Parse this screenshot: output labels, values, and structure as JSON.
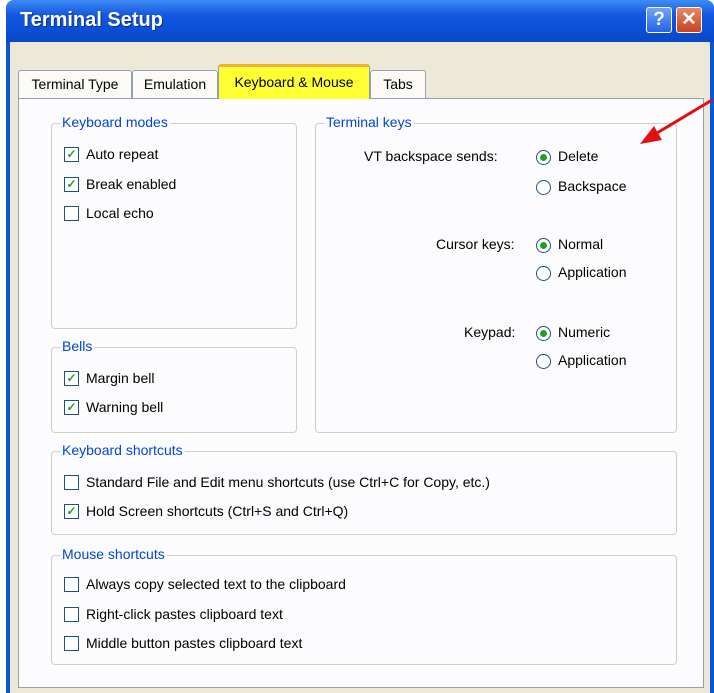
{
  "window": {
    "title": "Terminal Setup",
    "help_label": "?",
    "close_label": "✕"
  },
  "tabs": [
    {
      "label": "Terminal Type",
      "active": false
    },
    {
      "label": "Emulation",
      "active": false
    },
    {
      "label": "Keyboard & Mouse",
      "active": true
    },
    {
      "label": "Tabs",
      "active": false
    }
  ],
  "keyboard_modes": {
    "legend": "Keyboard modes",
    "items": [
      {
        "label": "Auto repeat",
        "checked": true
      },
      {
        "label": "Break enabled",
        "checked": true
      },
      {
        "label": "Local echo",
        "checked": false
      }
    ]
  },
  "bells": {
    "legend": "Bells",
    "items": [
      {
        "label": "Margin bell",
        "checked": true
      },
      {
        "label": "Warning bell",
        "checked": true
      }
    ]
  },
  "terminal_keys": {
    "legend": "Terminal keys",
    "vt_backspace": {
      "label": "VT backspace sends:",
      "options": [
        "Delete",
        "Backspace"
      ],
      "selected": "Delete"
    },
    "cursor_keys": {
      "label": "Cursor keys:",
      "options": [
        "Normal",
        "Application"
      ],
      "selected": "Normal"
    },
    "keypad": {
      "label": "Keypad:",
      "options": [
        "Numeric",
        "Application"
      ],
      "selected": "Numeric"
    }
  },
  "keyboard_shortcuts": {
    "legend": "Keyboard shortcuts",
    "items": [
      {
        "label": "Standard File and Edit menu shortcuts (use Ctrl+C for Copy, etc.)",
        "checked": false
      },
      {
        "label": "Hold Screen shortcuts (Ctrl+S and Ctrl+Q)",
        "checked": true
      }
    ]
  },
  "mouse_shortcuts": {
    "legend": "Mouse shortcuts",
    "items": [
      {
        "label": "Always copy selected text to the clipboard",
        "checked": false
      },
      {
        "label": "Right-click pastes clipboard text",
        "checked": false
      },
      {
        "label": "Middle button pastes clipboard text",
        "checked": false
      }
    ]
  },
  "colors": {
    "title_bar": "#0a56d6",
    "legend_text": "#0046d5",
    "active_tab_highlight": "#ffff33",
    "annotation_arrow": "#e01010"
  },
  "icons": {
    "check": "check-icon",
    "help": "help-icon",
    "close": "close-icon",
    "arrow": "red-arrow-annotation"
  }
}
